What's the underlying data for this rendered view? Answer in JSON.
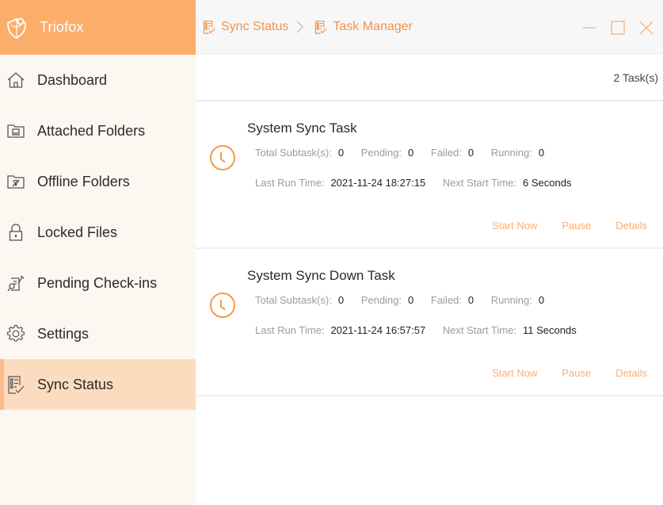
{
  "app": {
    "name": "Triofox",
    "brand_color": "#fbad6a",
    "accent_color": "#f3924a"
  },
  "sidebar": {
    "items": [
      {
        "label": "Dashboard",
        "icon": "home-icon",
        "active": false
      },
      {
        "label": "Attached Folders",
        "icon": "attached-folder-icon",
        "active": false
      },
      {
        "label": "Offline Folders",
        "icon": "offline-folder-icon",
        "active": false
      },
      {
        "label": "Locked Files",
        "icon": "lock-icon",
        "active": false
      },
      {
        "label": "Pending Check-ins",
        "icon": "pending-checkin-icon",
        "active": false
      },
      {
        "label": "Settings",
        "icon": "gear-icon",
        "active": false
      },
      {
        "label": "Sync Status",
        "icon": "checklist-icon",
        "active": true
      }
    ]
  },
  "header": {
    "breadcrumb": [
      {
        "label": "Sync Status",
        "icon": "checklist-icon"
      },
      {
        "label": "Task Manager",
        "icon": "checklist-icon"
      }
    ],
    "window_controls": [
      "minimize-icon",
      "maximize-icon",
      "close-icon"
    ]
  },
  "main": {
    "task_count": "2 Task(s)",
    "tasks": [
      {
        "title": "System Sync Task",
        "stats": [
          {
            "label": "Total Subtask(s):",
            "value": "0"
          },
          {
            "label": "Pending:",
            "value": "0"
          },
          {
            "label": "Failed:",
            "value": "0"
          },
          {
            "label": "Running:",
            "value": "0"
          }
        ],
        "last_run_label": "Last Run Time:",
        "last_run": "2021-11-24 18:27:15",
        "next_start_label": "Next Start Time:",
        "next_start": "6 Seconds",
        "actions": [
          "Start Now",
          "Pause",
          "Details"
        ]
      },
      {
        "title": "System Sync Down Task",
        "stats": [
          {
            "label": "Total Subtask(s):",
            "value": "0"
          },
          {
            "label": "Pending:",
            "value": "0"
          },
          {
            "label": "Failed:",
            "value": "0"
          },
          {
            "label": "Running:",
            "value": "0"
          }
        ],
        "last_run_label": "Last Run Time:",
        "last_run": "2021-11-24 16:57:57",
        "next_start_label": "Next Start Time:",
        "next_start": "11 Seconds",
        "actions": [
          "Start Now",
          "Pause",
          "Details"
        ]
      }
    ]
  }
}
